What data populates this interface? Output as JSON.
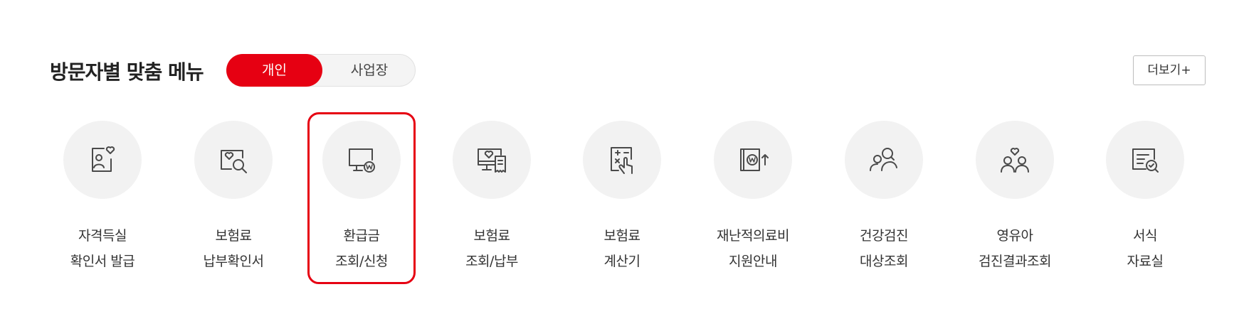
{
  "header": {
    "title": "방문자별 맞춤 메뉴",
    "tabs": [
      {
        "label": "개인",
        "selected": true
      },
      {
        "label": "사업장",
        "selected": false
      }
    ],
    "more_label": "더보기+"
  },
  "colors": {
    "accent": "#e60012",
    "icon_bg": "#f2f2f2",
    "icon_stroke": "#4a4a4a"
  },
  "menu": {
    "items": [
      {
        "icon": "id-card-heart-icon",
        "line1": "자격득실",
        "line2": "확인서 발급"
      },
      {
        "icon": "document-search-icon",
        "line1": "보험료",
        "line2": "납부확인서"
      },
      {
        "icon": "monitor-won-icon",
        "line1": "환급금",
        "line2": "조회/신청",
        "highlighted": true
      },
      {
        "icon": "monitor-receipt-icon",
        "line1": "보험료",
        "line2": "조회/납부"
      },
      {
        "icon": "calculator-hand-icon",
        "line1": "보험료",
        "line2": "계산기"
      },
      {
        "icon": "book-won-up-icon",
        "line1": "재난적의료비",
        "line2": "지원안내"
      },
      {
        "icon": "people-search-icon",
        "line1": "건강검진",
        "line2": "대상조회"
      },
      {
        "icon": "family-heart-icon",
        "line1": "영유아",
        "line2": "검진결과조회"
      },
      {
        "icon": "document-check-icon",
        "line1": "서식",
        "line2": "자료실"
      }
    ]
  }
}
